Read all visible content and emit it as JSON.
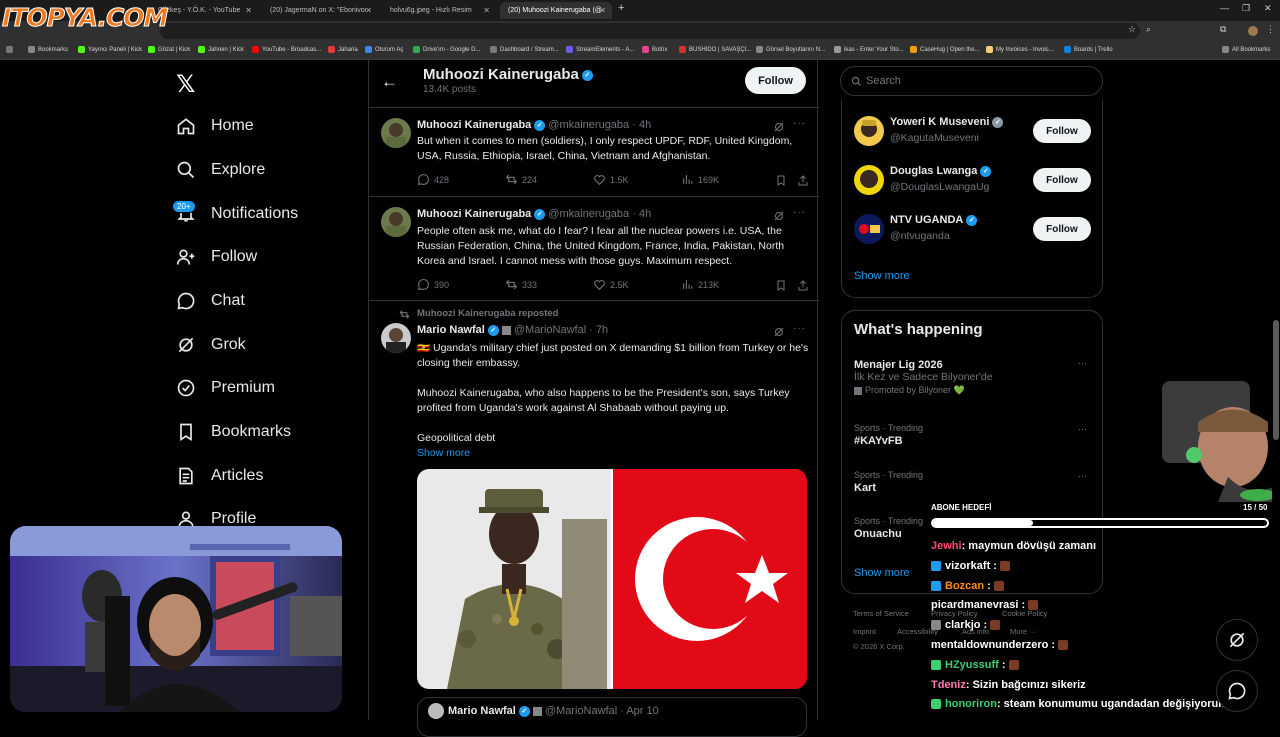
{
  "browser": {
    "tabs": [
      {
        "label": "Çilekeş - Y.Ö.K. - YouTube",
        "active": false
      },
      {
        "label": "(20) JagermaN on X: \"Ebonivon",
        "active": false
      },
      {
        "label": "holvu6g.jpeg - Hızlı Resim",
        "active": false
      },
      {
        "label": "(20) Muhoozi Kainerugaba (@",
        "active": true
      }
    ],
    "overlay_logo": "ITOPYA.COM",
    "bookmarks": [
      "Bookmarks",
      "Yayıncı Paneli | Kick",
      "Gözat | Kick",
      "Jahrein | Kick",
      "YouTube - Broadcas...",
      "Jaharia",
      "Oturum Aç",
      "Drive'ım - Google D...",
      "Dashboard / Stream...",
      "StreamElements - A...",
      "Botrix",
      "BUSHIDO | SAVAŞÇI...",
      "Görsel Boyutlarını N...",
      "ikas - Enter Your Sto...",
      "CaseHug | Open the...",
      "My Invoices - Invoic...",
      "Boards | Trello",
      "All Bookmarks"
    ]
  },
  "nav": {
    "items": [
      "Home",
      "Explore",
      "Notifications",
      "Follow",
      "Chat",
      "Grok",
      "Premium",
      "Bookmarks",
      "Articles",
      "Profile"
    ],
    "notif_badge": "20+"
  },
  "header": {
    "name": "Muhoozi Kainerugaba",
    "posts": "13.4K posts",
    "follow": "Follow"
  },
  "tweets": [
    {
      "name": "Muhoozi Kainerugaba",
      "handle": "@mkainerugaba",
      "time": "· 4h",
      "text": "But when it comes to men (soldiers), I only respect UPDF, RDF, United Kingdom, USA, Russia, Ethiopia, Israel, China, Vietnam and Afghanistan.",
      "replies": "428",
      "reposts": "224",
      "likes": "1.5K",
      "views": "169K"
    },
    {
      "name": "Muhoozi Kainerugaba",
      "handle": "@mkainerugaba",
      "time": "· 4h",
      "text": "People often ask me, what do I fear? I fear all the nuclear powers i.e. USA, the Russian Federation, China, the United Kingdom, France, India, Pakistan, North Korea and Israel. I cannot mess with those guys. Maximum respect.",
      "replies": "390",
      "reposts": "333",
      "likes": "2.5K",
      "views": "213K"
    },
    {
      "repost_label": "Muhoozi Kainerugaba reposted",
      "name": "Mario Nawfal",
      "handle": "@MarioNawfal",
      "time": "· 7h",
      "text1": "🇺🇬 Uganda's military chief just posted on X demanding $1 billion from Turkey or he's closing their embassy.",
      "text2": "Muhoozi Kainerugaba, who also happens to be the President's son, says Turkey profited from Uganda's work against Al Shabaab without paying up.",
      "text3": "Geopolitical debt",
      "show_more": "Show more",
      "quote_name": "Mario Nawfal",
      "quote_handle": "@MarioNawfal",
      "quote_time": "· Apr 10"
    }
  ],
  "right": {
    "search_placeholder": "Search",
    "who_to_follow": [
      {
        "name": "Yoweri K Museveni",
        "handle": "@KagutaMuseveni",
        "button": "Follow"
      },
      {
        "name": "Douglas Lwanga",
        "handle": "@DouglasLwangaUg",
        "button": "Follow"
      },
      {
        "name": "NTV UGANDA",
        "handle": "@ntvuganda",
        "button": "Follow"
      }
    ],
    "show_more_1": "Show more",
    "happening_title": "What's happening",
    "trends": [
      {
        "meta": "",
        "title": "Menajer Lig 2026",
        "sub": "İlk Kez ve Sadece Bilyoner'de",
        "promo": "Promoted by Bilyoner 💚"
      },
      {
        "meta": "Sports · Trending",
        "title": "#KAYvFB"
      },
      {
        "meta": "Sports · Trending",
        "title": "Kart"
      },
      {
        "meta": "Sports · Trending",
        "title": "Onuachu"
      }
    ],
    "show_more_2": "Show more",
    "footer": [
      "Terms of Service",
      "Privacy Policy",
      "Cookie Policy",
      "Imprint",
      "Accessibility",
      "Ads info",
      "More ···",
      "© 2026 X Corp."
    ]
  },
  "stream": {
    "goal_label": "ABONE HEDEFİ",
    "goal_count": "15 / 50",
    "goal_fraction": 0.3,
    "chat": [
      {
        "user": "Jewhi",
        "msg": ": maymun dövüşü zamanı",
        "color": "#ff4d6d"
      },
      {
        "user": "vizorkaft",
        "msg": " :",
        "color": "#ffffff"
      },
      {
        "user": "Bozcan",
        "msg": " :",
        "color": "#ff8c1a"
      },
      {
        "user": "picardmanevrasi",
        "msg": " :",
        "color": "#ffffff"
      },
      {
        "user": "clarkjo",
        "msg": " :",
        "color": "#ffffff"
      },
      {
        "user": "mentaldownunderzero",
        "msg": " :",
        "color": "#ffffff"
      },
      {
        "user": "HZyussuff",
        "msg": " :",
        "color": "#3cd070"
      },
      {
        "user": "Tdeniz",
        "msg": ": Sizin bağcınızı sikeriz",
        "color": "#ff7ab6"
      },
      {
        "user": "honoriron",
        "msg": ": steam konumumu ugandadan değişiyorum",
        "color": "#3cd070"
      }
    ]
  },
  "colors": {
    "accent": "#1d9bf0",
    "bg": "#000000",
    "border": "#2f3336",
    "muted": "#71767b"
  }
}
